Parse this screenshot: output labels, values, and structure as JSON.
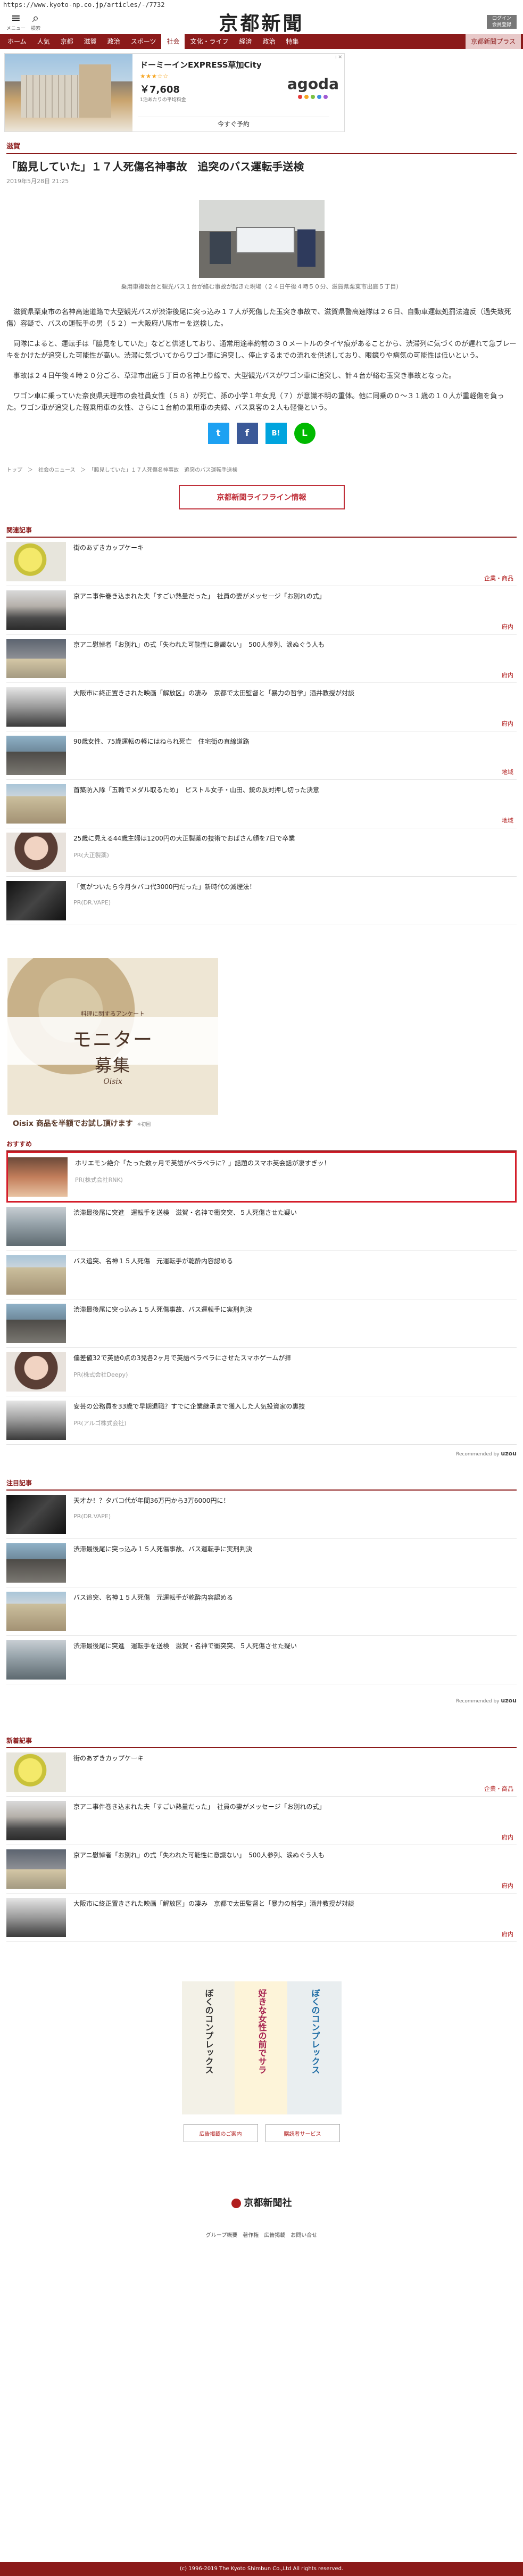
{
  "browser": {
    "url": "https://www.kyoto-np.co.jp/articles/-/7732"
  },
  "header": {
    "menu_label": "メニュー",
    "search_label": "検索",
    "logo": "京都新聞",
    "account_label": "ログイン\n会員登録"
  },
  "nav": {
    "items": [
      "ホーム",
      "人気",
      "京都",
      "滋賀",
      "政治",
      "スポーツ",
      "社会",
      "文化・ライフ",
      "経済",
      "政治",
      "特集",
      "京都新聞プラス"
    ],
    "active": "社会"
  },
  "ad_top": {
    "hotel_name": "ドーミーインEXPRESS草加City",
    "stars": "★★★☆☆",
    "price": "￥7,608",
    "price_note": "1泊あたりの平均料金",
    "book_label": "今すぐ予約",
    "brand": "agoda",
    "brand_dot_colors": [
      "#e63c3c",
      "#f6a623",
      "#7cc242",
      "#3d8fe0",
      "#a05ad4"
    ],
    "ad_mark": "i ✕"
  },
  "article": {
    "section": "滋賀",
    "title": "「脇見していた」１７人死傷名神事故　追突のバス運転手送検",
    "date": "2019年5月28日 21:25",
    "caption": "乗用車複数台と観光バス１台が絡む事故が起きた現場（２４日午後４時５０分、滋賀県栗東市出庭５丁目）",
    "paragraphs": [
      "滋賀県栗東市の名神高速道路で大型観光バスが渋滞後尾に突っ込み１７人が死傷した玉突き事故で、滋賀県警高速隊は２６日、自動車運転処罰法違反（過失致死傷）容疑で、バスの運転手の男（５２）＝大阪府八尾市＝を送検した。",
      "同隊によると、運転手は「脇見をしていた」などと供述しており、通常用途率約前の３０メートルのタイヤ痕があることから、渋滞列に気づくのが遅れて急ブレーキをかけたが追突した可能性が高い。渋滞に気づいてからワゴン車に追突し、停止するまでの流れを供述しており、眼鏡りや病気の可能性は低いという。",
      "事故は２４日午後４時２０分ごろ、草津市出庭５丁目の名神上り線で、大型観光バスがワゴン車に追突し、計４台が絡む玉突き事故となった。",
      "ワゴン車に乗っていた奈良県天理市の会社員女性（５８）が死亡、孫の小学１年女児（７）が意識不明の重体。他に同乗の０〜３１歳の１０人が重軽傷を負った。ワゴン車が追突した軽乗用車の女性、さらに１台前の乗用車の夫婦、バス乗客の２人も軽傷という。"
    ]
  },
  "share": {
    "twitter": "t",
    "facebook": "f",
    "hatena": "B!",
    "line": "L"
  },
  "breadcrumb": "トップ　＞　社会のニュース　＞　「脇見していた」１７人死傷名神事故　追突のバス運転手送検",
  "lifeline_label": "京都新聞ライフライン情報",
  "related": {
    "title": "関連記事",
    "items": [
      {
        "title": "街のあずきカップケーキ",
        "cat": "企業・商品",
        "thumb": "th-yellow"
      },
      {
        "title": "京アニ事件巻き込まれた夫「すごい熱量だった」　社員の妻がメッセージ「お別れの式」",
        "cat": "府内",
        "thumb": "th-people"
      },
      {
        "title": "京アニ慰悼者「お別れ」の式「失われた可能性に意識ない」　500人参列、涙ぬぐう人も",
        "cat": "府内",
        "thumb": "th-sign"
      },
      {
        "title": "大阪市に終正置きされた映画「解放区」の凄み　京都で太田監督と「暴力の哲学」酒井教授が対談",
        "cat": "府内",
        "thumb": "th-mono"
      },
      {
        "title": "90歳女性、75歳運転の軽にはねられ死亡　住宅街の直線道路",
        "cat": "地域",
        "thumb": "th-cars"
      },
      {
        "title": "首築防入隊「五輪でメダル取るため」　ピストル女子・山田、銃の反対押し切った決意",
        "cat": "地域",
        "thumb": "th-bldg"
      },
      {
        "title": "25歳に見える44歳主婦は1200円の大正製薬の技術でおばさん顔を7日で卒業",
        "pr": "PR(大正製薬)",
        "thumb": "th-girl"
      },
      {
        "title": "「気がついたら今月タバコ代3000円だった」新時代の減煙法！",
        "pr": "PR(DR.VAPE)",
        "thumb": "th-phone"
      }
    ]
  },
  "big_ad": {
    "top_line": "料理に関するアンケート",
    "headline": "モニター",
    "headline2": "募集",
    "brand": "Oisix",
    "footer": "Oisix 商品を半額でお試し頂けます",
    "footer_note": "※初回"
  },
  "recommended": {
    "title": "おすすめ",
    "highlight": {
      "title": "ホリエモン絶介「たった数ヶ月で英語がペラペラに？」話題のスマホ英会話が凄すぎッ！",
      "pr": "PR(株式会社RNK)",
      "thumb": "th-pr"
    },
    "items": [
      {
        "title": "渋滞最後尾に突進　運転手を送検　滋賀・名神で衝突突、５人死傷させた疑い",
        "thumb": "th-bus"
      },
      {
        "title": "バス追突、名神１５人死傷　元運転手が乾酔内容認める",
        "thumb": "th-bldg"
      },
      {
        "title": "渋滞最後尾に突っ込み１５人死傷事故、バス運転手に実刑判決",
        "thumb": "th-cars"
      },
      {
        "title": "偏差値32で英語0点の3兒各2ヶ月で英語ペラペラにさせたスマホゲームが拝",
        "pr": "PR(株式会社Deepy)",
        "thumb": "th-girl"
      },
      {
        "title": "安芸の公務員を33歳で早期退職？すでに企業継承まで獲入した人気投資家の裏技",
        "pr": "PR(アルゴ株式会社)",
        "thumb": "th-mono"
      }
    ],
    "powered": "Recommended by",
    "powered_brand": "uzou"
  },
  "attention": {
    "title": "注目記事",
    "items": [
      {
        "title": "天才か！？タバコ代が年間36万円から3万6000円に！",
        "pr": "PR(DR.VAPE)",
        "thumb": "th-phone"
      },
      {
        "title": "渋滞最後尾に突っ込み１５人死傷事故、バス運転手に実刑判決",
        "thumb": "th-cars"
      },
      {
        "title": "バス追突、名神１５人死傷　元運転手が乾酔内容認める",
        "thumb": "th-bldg"
      },
      {
        "title": "渋滞最後尾に突進　運転手を送検　滋賀・名神で衝突突、５人死傷させた疑い",
        "thumb": "th-bus"
      }
    ],
    "powered": "Recommended by",
    "powered_brand": "uzou"
  },
  "newest": {
    "title": "新着記事",
    "items": [
      {
        "title": "街のあずきカップケーキ",
        "cat": "企業・商品",
        "thumb": "th-yellow"
      },
      {
        "title": "京アニ事件巻き込まれた夫「すごい熱量だった」　社員の妻がメッセージ「お別れの式」",
        "cat": "府内",
        "thumb": "th-people"
      },
      {
        "title": "京アニ慰悼者「お別れ」の式「失われた可能性に意識ない」　500人参列、涙ぬぐう人も",
        "cat": "府内",
        "thumb": "th-sign"
      },
      {
        "title": "大阪市に終正置きされた映画「解放区」の凄み　京都で太田監督と「暴力の哲学」酒井教授が対談",
        "cat": "府内",
        "thumb": "th-mono"
      }
    ]
  },
  "bottom_ad": {
    "col1": "ぼくのコンプレックス",
    "col2": "好きな女性の前でサラ",
    "col3": "ぼくのコンプレックス"
  },
  "footer": {
    "link1": "広告掲載のご案内",
    "link2": "購読者サービス",
    "logo": "京都新聞社",
    "nav": "グループ概要　著作権　広告掲載　お問い合せ",
    "copyright": "(c) 1996-2019 The Kyoto Shimbun Co.,Ltd All rights reserved."
  }
}
